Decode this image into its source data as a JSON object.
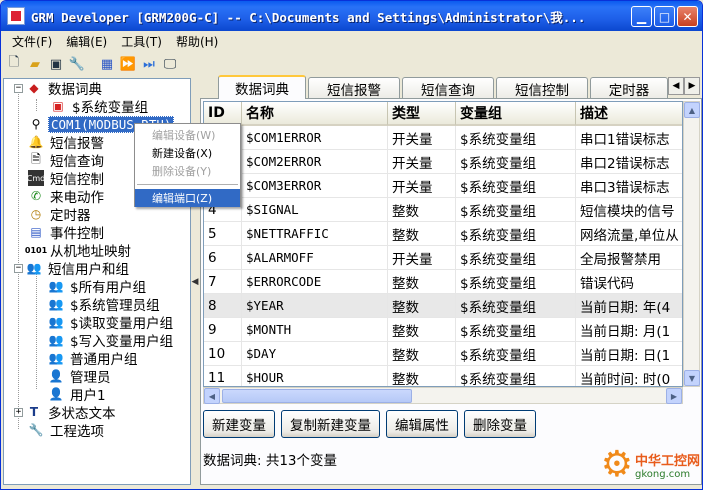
{
  "window": {
    "title": "GRM Developer [GRM200G-C]  -- C:\\Documents and Settings\\Administrator\\我..."
  },
  "menubar": [
    "文件(F)",
    "编辑(E)",
    "工具(T)",
    "帮助(H)"
  ],
  "toolbar_icons": [
    "new-file-icon",
    "open-folder-icon",
    "save-icon",
    "wrench-icon",
    "grid-icon",
    "download-icon",
    "upload-icon",
    "monitor-icon"
  ],
  "tree": {
    "items": [
      {
        "label": "数据词典",
        "icon": "book-icon",
        "level": 0,
        "expander": "-"
      },
      {
        "label": "$系统变量组",
        "icon": "folder-red-icon",
        "level": 1,
        "expander": ""
      },
      {
        "label": "COM1(MODBUS_RTU)",
        "icon": "plug-icon",
        "level": 0,
        "expander": "",
        "selected": true
      },
      {
        "label": "短信报警",
        "icon": "bell-icon",
        "level": 0,
        "expander": ""
      },
      {
        "label": "短信查询",
        "icon": "doc-icon",
        "level": 0,
        "expander": ""
      },
      {
        "label": "短信控制",
        "icon": "cmd-icon",
        "level": 0,
        "expander": ""
      },
      {
        "label": "来电动作",
        "icon": "phone-icon",
        "level": 0,
        "expander": ""
      },
      {
        "label": "定时器",
        "icon": "clock-icon",
        "level": 0,
        "expander": ""
      },
      {
        "label": "事件控制",
        "icon": "event-icon",
        "level": 0,
        "expander": ""
      },
      {
        "label": "从机地址映射",
        "icon": "binary-icon",
        "level": 0,
        "expander": ""
      },
      {
        "label": "短信用户和组",
        "icon": "users-icon",
        "level": 0,
        "expander": "-"
      },
      {
        "label": "$所有用户组",
        "icon": "group-icon",
        "level": 1,
        "expander": ""
      },
      {
        "label": "$系统管理员组",
        "icon": "group-icon",
        "level": 1,
        "expander": ""
      },
      {
        "label": "$读取变量用户组",
        "icon": "group-icon",
        "level": 1,
        "expander": ""
      },
      {
        "label": "$写入变量用户组",
        "icon": "group-icon",
        "level": 1,
        "expander": ""
      },
      {
        "label": "普通用户组",
        "icon": "group-icon",
        "level": 1,
        "expander": ""
      },
      {
        "label": "管理员",
        "icon": "user-icon",
        "level": 1,
        "expander": ""
      },
      {
        "label": "用户1",
        "icon": "user-icon",
        "level": 1,
        "expander": ""
      },
      {
        "label": "多状态文本",
        "icon": "text-icon",
        "level": 0,
        "expander": "+"
      },
      {
        "label": "工程选项",
        "icon": "tools-icon",
        "level": 0,
        "expander": ""
      }
    ]
  },
  "context_menu": {
    "items": [
      {
        "label": "编辑设备(W)",
        "disabled": true
      },
      {
        "label": "新建设备(X)",
        "disabled": false
      },
      {
        "label": "删除设备(Y)",
        "disabled": true
      },
      {
        "label": "编辑端口(Z)",
        "disabled": false,
        "highlighted": true
      }
    ]
  },
  "tabs": [
    "数据词典",
    "短信报警",
    "短信查询",
    "短信控制",
    "定时器"
  ],
  "grid": {
    "columns": [
      "ID",
      "名称",
      "类型",
      "变量组",
      "描述"
    ],
    "rows": [
      [
        "1",
        "$COM1ERROR",
        "开关量",
        "$系统变量组",
        "串口1错误标志"
      ],
      [
        "2",
        "$COM2ERROR",
        "开关量",
        "$系统变量组",
        "串口2错误标志"
      ],
      [
        "3",
        "$COM3ERROR",
        "开关量",
        "$系统变量组",
        "串口3错误标志"
      ],
      [
        "4",
        "$SIGNAL",
        "整数",
        "$系统变量组",
        "短信模块的信号"
      ],
      [
        "5",
        "$NETTRAFFIC",
        "整数",
        "$系统变量组",
        "网络流量,单位从"
      ],
      [
        "6",
        "$ALARMOFF",
        "开关量",
        "$系统变量组",
        "全局报警禁用"
      ],
      [
        "7",
        "$ERRORCODE",
        "整数",
        "$系统变量组",
        "错误代码"
      ],
      [
        "8",
        "$YEAR",
        "整数",
        "$系统变量组",
        "当前日期: 年(4"
      ],
      [
        "9",
        "$MONTH",
        "整数",
        "$系统变量组",
        "当前日期: 月(1"
      ],
      [
        "10",
        "$DAY",
        "整数",
        "$系统变量组",
        "当前日期: 日(1"
      ],
      [
        "11",
        "$HOUR",
        "整数",
        "$系统变量组",
        "当前时间: 时(0"
      ]
    ],
    "selected_row": 7
  },
  "buttons": {
    "new_var": "新建变量",
    "copy_new_var": "复制新建变量",
    "edit_props": "编辑属性",
    "delete_var": "删除变量"
  },
  "status": "数据词典: 共13个变量",
  "watermark": {
    "name": "中华工控网",
    "url": "gkong.com"
  }
}
